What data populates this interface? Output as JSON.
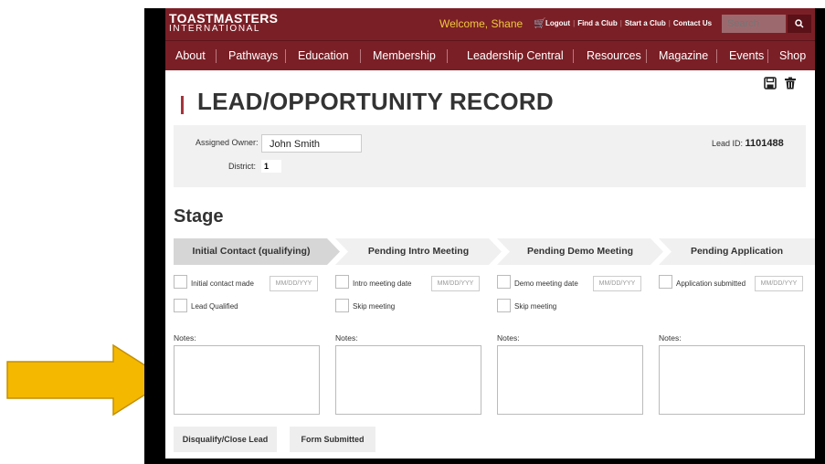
{
  "header": {
    "logo": "TOASTMASTERS",
    "logo_sub": "INTERNATIONAL",
    "welcome": "Welcome, Shane",
    "links": [
      "Logout",
      "Find a Club",
      "Start a Club",
      "Contact Us"
    ],
    "search_placeholder": "Search",
    "colors": {
      "bar": "#7b1f26",
      "welcome": "#f0c93d"
    }
  },
  "nav": {
    "items": [
      "About",
      "Pathways",
      "Education",
      "Membership",
      "Leadership Central",
      "Resources",
      "Magazine",
      "Events",
      "Shop"
    ]
  },
  "page": {
    "title": "LEAD/OPPORTUNITY RECORD",
    "owner_label": "Assigned Owner:",
    "owner_value": "John Smith",
    "district_label": "District:",
    "district_value": "1",
    "lead_label": "Lead ID:",
    "lead_value": "1101488"
  },
  "stage": {
    "title": "Stage",
    "steps": [
      {
        "label": "Initial Contact (qualifying)",
        "active": true,
        "checks": [
          "Initial contact made",
          "Lead Qualified"
        ],
        "date_placeholder": "MM/DD/YYY",
        "notes_label": "Notes:"
      },
      {
        "label": "Pending Intro Meeting",
        "active": false,
        "checks": [
          "Intro meeting date",
          "Skip meeting"
        ],
        "date_placeholder": "MM/DD/YYY",
        "notes_label": "Notes:"
      },
      {
        "label": "Pending Demo Meeting",
        "active": false,
        "checks": [
          "Demo meeting date",
          "Skip meeting"
        ],
        "date_placeholder": "MM/DD/YYY",
        "notes_label": "Notes:"
      },
      {
        "label": "Pending Application",
        "active": false,
        "checks": [
          "Application submitted"
        ],
        "date_placeholder": "MM/DD/YYY",
        "notes_label": "Notes:"
      }
    ]
  },
  "buttons": {
    "disqualify": "Disqualify/Close Lead",
    "submitted": "Form Submitted"
  },
  "annotation": {
    "arrow_color": "#f5b800",
    "arrow_icon": "arrow-right-icon"
  }
}
